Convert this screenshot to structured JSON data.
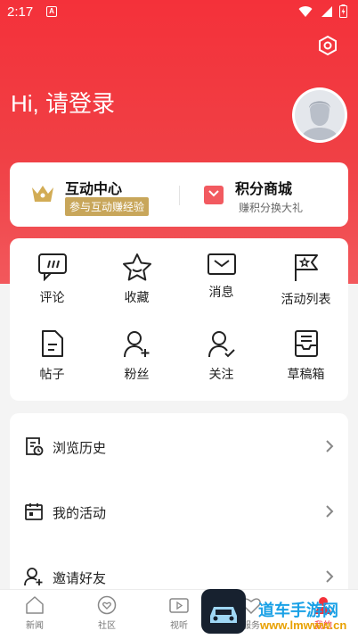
{
  "status_bar": {
    "time": "2:17",
    "notif_letter": "A"
  },
  "header": {
    "greeting": "Hi, 请登录"
  },
  "top_card": {
    "interaction": {
      "title": "互动中心",
      "subtitle": "参与互动赚经验"
    },
    "points": {
      "title": "积分商城",
      "subtitle": "赚积分换大礼"
    }
  },
  "grid": {
    "items": [
      {
        "label": "评论",
        "icon": "comment-icon"
      },
      {
        "label": "收藏",
        "icon": "star-icon"
      },
      {
        "label": "消息",
        "icon": "mail-icon"
      },
      {
        "label": "活动列表",
        "icon": "flag-icon"
      },
      {
        "label": "帖子",
        "icon": "post-icon"
      },
      {
        "label": "粉丝",
        "icon": "follower-icon"
      },
      {
        "label": "关注",
        "icon": "follow-icon"
      },
      {
        "label": "草稿箱",
        "icon": "draft-box-icon"
      }
    ]
  },
  "menu": {
    "items": [
      {
        "label": "浏览历史",
        "icon": "history-icon"
      },
      {
        "label": "我的活动",
        "icon": "calendar-icon"
      },
      {
        "label": "邀请好友",
        "icon": "invite-icon"
      }
    ]
  },
  "tabbar": {
    "items": [
      {
        "label": "新闻",
        "icon": "home-icon"
      },
      {
        "label": "社区",
        "icon": "community-icon"
      },
      {
        "label": "视听",
        "icon": "video-icon"
      },
      {
        "label": "服务",
        "icon": "service-icon"
      },
      {
        "label": "我的",
        "icon": "profile-icon"
      }
    ]
  },
  "watermark": {
    "text": "道车手游网",
    "url": "www.lmwww.cn"
  },
  "colors": {
    "brand_red": "#f4313a",
    "gold": "#c8a65a",
    "text": "#222222",
    "watermark_blue": "#1aa1e6"
  }
}
